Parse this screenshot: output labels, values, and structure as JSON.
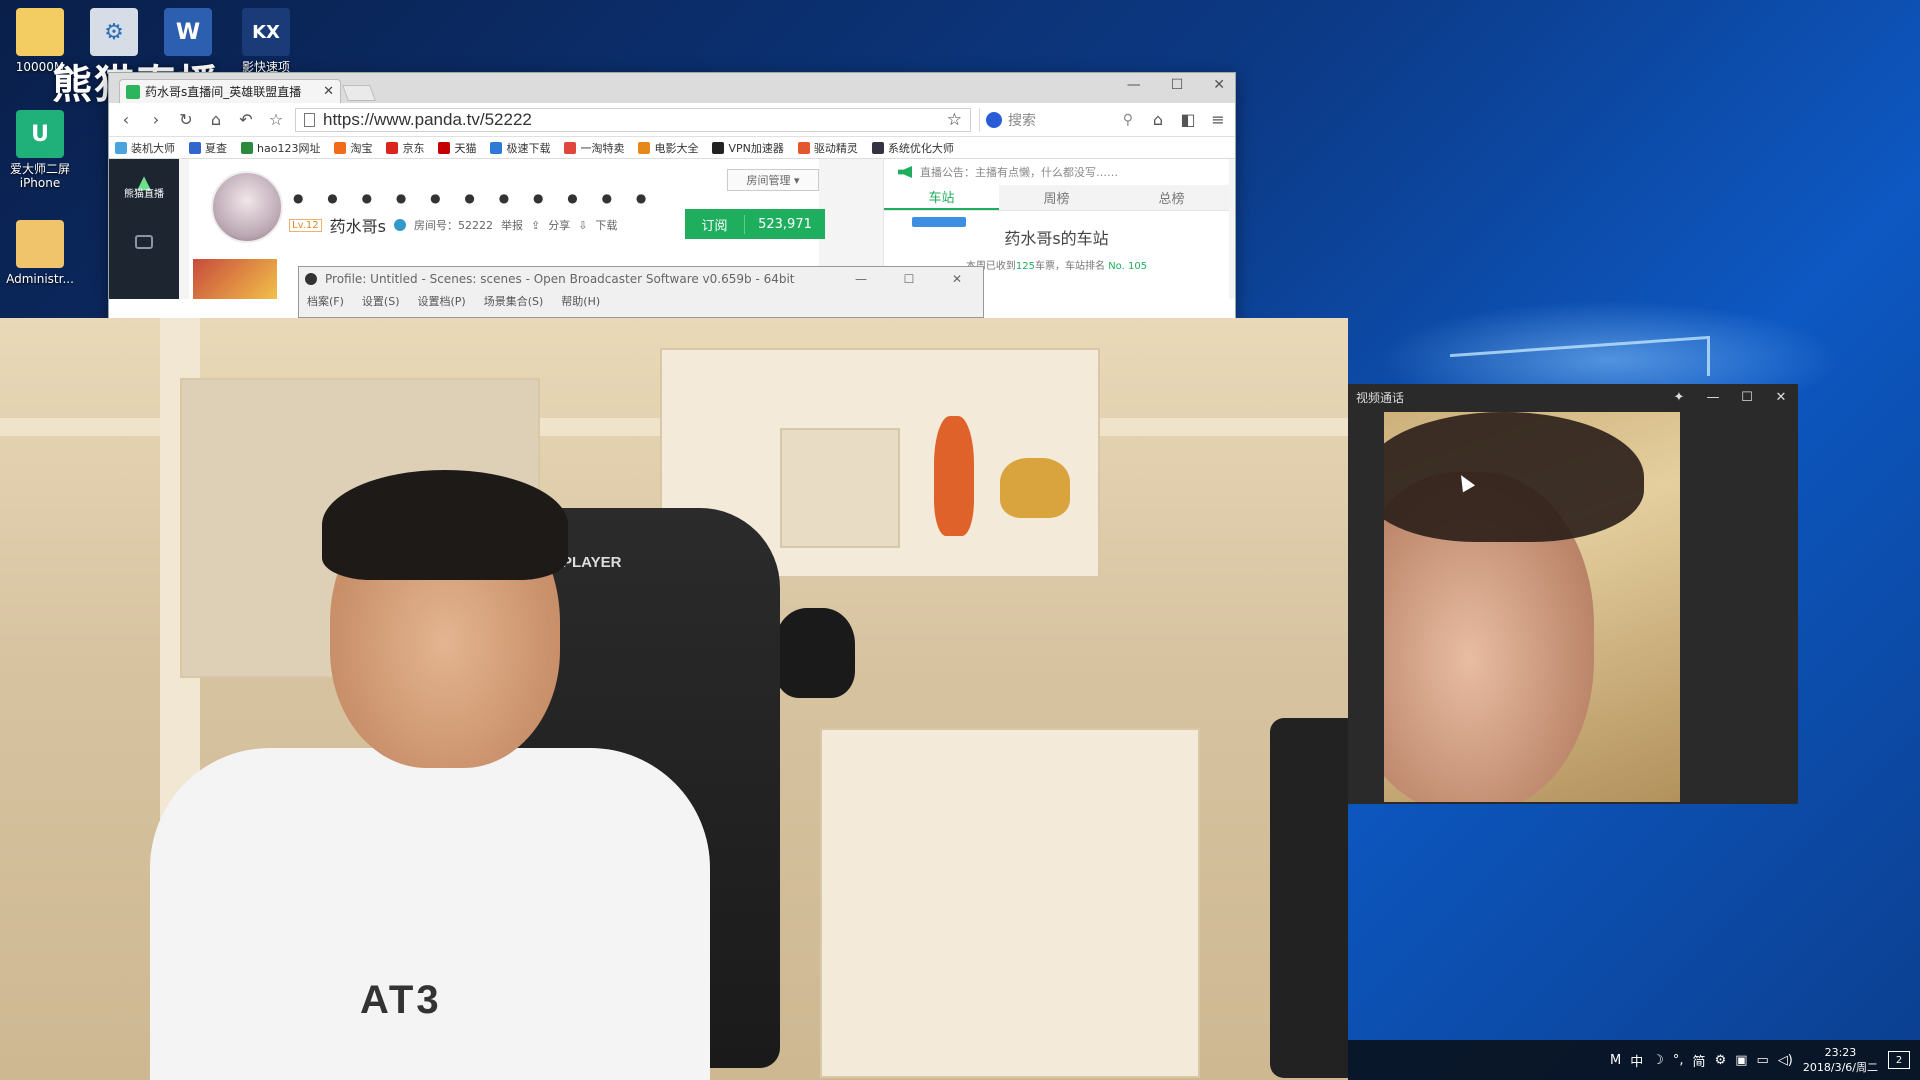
{
  "desktop": {
    "watermark": "熊猫直播",
    "icons": [
      {
        "label": "10000M",
        "icon": "folder-icon"
      },
      {
        "label": "",
        "icon": "settings-app-icon"
      },
      {
        "label": "",
        "icon": "word-doc-icon"
      },
      {
        "label": "影快速项",
        "icon": "kx-app-icon"
      },
      {
        "label": "爱大师二屏 iPhone",
        "icon": "u-app-icon"
      },
      {
        "label": "Administr...",
        "icon": "user-folder-icon"
      }
    ]
  },
  "browser": {
    "tab_title": "药水哥s直播间_英雄联盟直播",
    "url": "https://www.panda.tv/52222",
    "search_placeholder": "搜索",
    "bookmarks": [
      "装机大师",
      "夏查",
      "hao123网址",
      "淘宝",
      "京东",
      "天猫",
      "极速下载",
      "一淘特卖",
      "电影大全",
      "VPN加速器",
      "驱动精灵",
      "系统优化大师"
    ],
    "page": {
      "logo_text": "熊猫直播",
      "room_manage": "房间管理",
      "level": "Lv.12",
      "streamer_name": "药水哥s",
      "room_id_label": "房间号：52222",
      "report": "举报",
      "share": "分享",
      "download": "下载",
      "subscribe_label": "订阅",
      "subscribe_count": "523,971",
      "notice": "直播公告：主播有点懒，什么都没写……",
      "panel_tabs": [
        "车站",
        "周榜",
        "总榜"
      ],
      "station_title": "药水哥s的车站",
      "station_info_prefix": "本周已收到",
      "station_info_count": "125",
      "station_info_mid": "车票，车站排名",
      "station_info_rank": "No. 105"
    }
  },
  "obs": {
    "title": "Profile: Untitled - Scenes: scenes - Open Broadcaster Software v0.659b - 64bit",
    "menu": [
      "档案(F)",
      "设置(S)",
      "设置档(P)",
      "场景集合(S)",
      "帮助(H)"
    ]
  },
  "webcam": {
    "chair_brand": "XPLAYER",
    "shirt_print": "AT3"
  },
  "call_window": {
    "title": "视频通话"
  },
  "taskbar": {
    "tray": [
      "M",
      "中",
      "☽",
      "°,",
      "简",
      "⚙"
    ],
    "time": "23:23",
    "date": "2018/3/6/周二",
    "notif_count": "2"
  },
  "colors": {
    "panda_green": "#1fae5e",
    "desktop_blue": "#0c3a86"
  }
}
